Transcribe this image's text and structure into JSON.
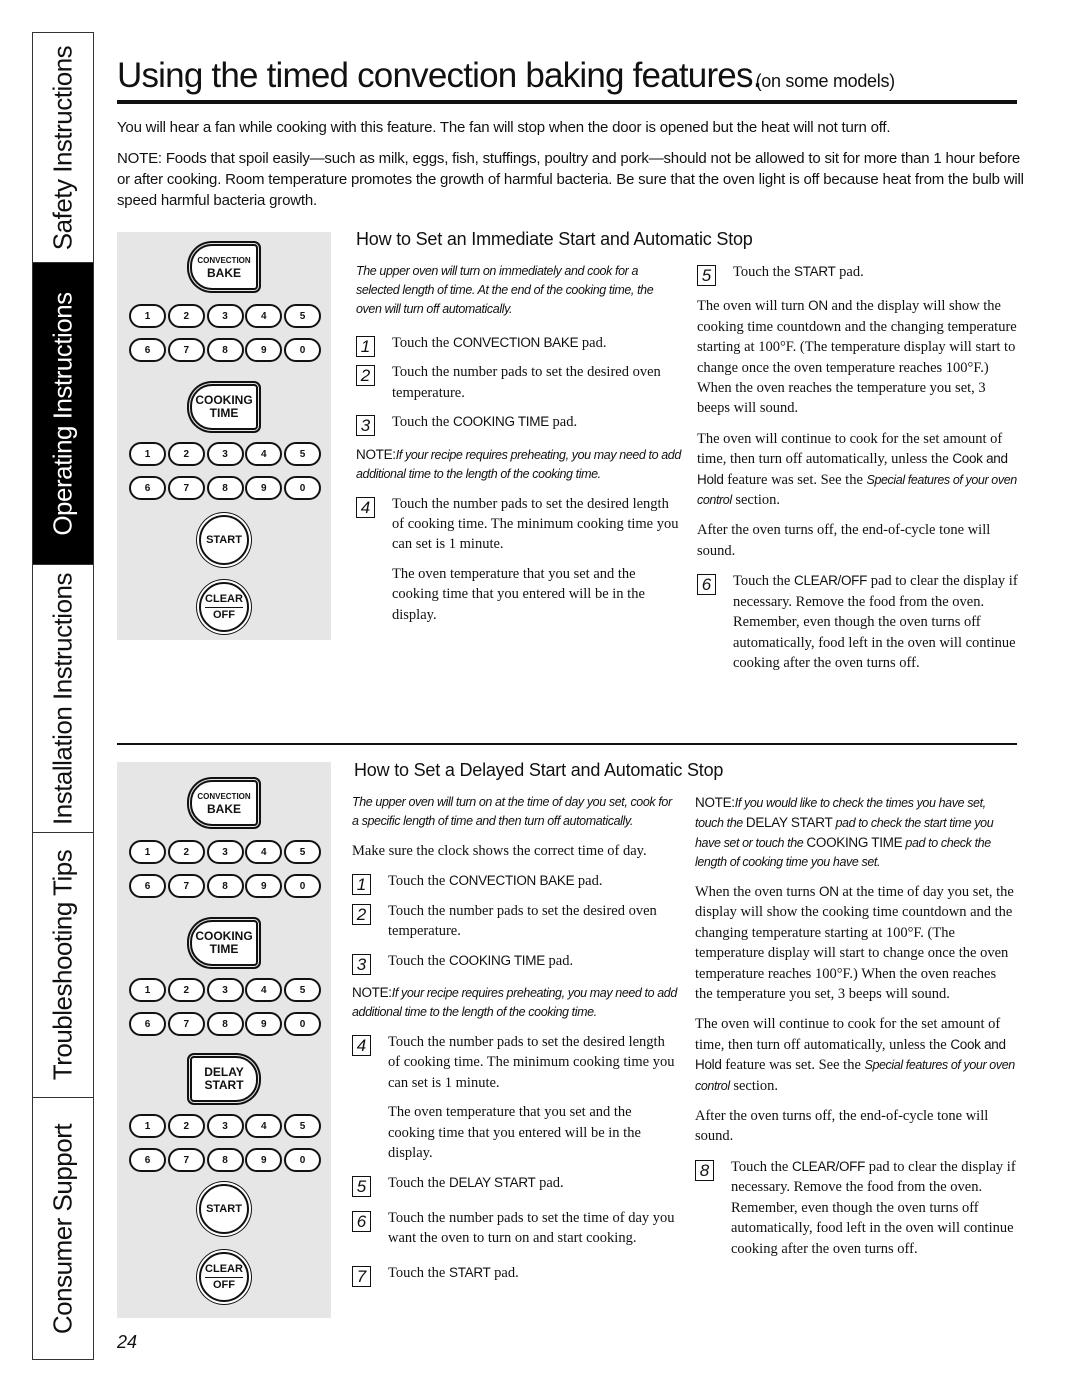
{
  "side_tabs": [
    {
      "label": "Safety Instructions",
      "active": false
    },
    {
      "label": "Operating Instructions",
      "active": true
    },
    {
      "label": "Installation Instructions",
      "active": false
    },
    {
      "label": "Troubleshooting Tips",
      "active": false
    },
    {
      "label": "Consumer Support",
      "active": false
    }
  ],
  "header": {
    "title": "Using the timed convection baking features.",
    "subtitle": "(on some models)"
  },
  "intro": {
    "fan_text": "You will hear a fan while cooking with this feature. The fan will stop when the door is opened but the heat will not turn off.",
    "note_label": "NOTE:",
    "note_text": "Foods that spoil easily—such as milk, eggs, fish, stuffings, poultry and pork—should not be allowed to sit for more than 1 hour before or after cooking. Room temperature promotes the growth of harmful bacteria. Be sure that the oven light is off because heat from the bulb will speed harmful bacteria growth."
  },
  "keypad": {
    "convection_bake": [
      "CONVECTION",
      "BAKE"
    ],
    "cooking_time": [
      "COOKING",
      "TIME"
    ],
    "delay_start": [
      "DELAY",
      "START"
    ],
    "start": "START",
    "clear_off": [
      "CLEAR",
      "OFF"
    ],
    "digits_row1": [
      "1",
      "2",
      "3",
      "4",
      "5"
    ],
    "digits_row2": [
      "6",
      "7",
      "8",
      "9",
      "0"
    ]
  },
  "immediate": {
    "heading": "How to Set an Immediate Start and Automatic Stop",
    "lead": "The upper oven will turn on immediately and cook for a selected length of time. At the end of the cooking time, the oven will turn off automatically.",
    "steps": [
      {
        "num": "1",
        "pre": "Touch the ",
        "key": "CONVECTION BAKE",
        "post": " pad."
      },
      {
        "num": "2",
        "text": "Touch the number pads to set the desired oven temperature."
      },
      {
        "num": "3",
        "pre": "Touch the ",
        "key": "COOKING TIME",
        "post": " pad."
      },
      {
        "num": "4",
        "text": "Touch the number pads to set the desired length of cooking time. The minimum cooking time you can set is 1 minute."
      },
      {
        "num": "5",
        "pre": "Touch the ",
        "key": "START",
        "post": " pad."
      },
      {
        "num": "6",
        "pre": "Touch the ",
        "key": "CLEAR/OFF",
        "post": " pad to clear the display if necessary. Remove the food from the oven. Remember, even though the oven turns off automatically, food left in the oven will continue cooking after the oven turns off."
      }
    ],
    "note_label": "NOTE:",
    "note_text": "If your recipe requires preheating, you may need to add additional time to the length of the cooking time.",
    "step4_followup": "The oven temperature that you set and the cooking time that you entered will be in the display.",
    "on_text_pre": "The oven will turn ",
    "on_key": "ON",
    "on_text_post": " and the display will show the cooking time countdown and the changing temperature starting at 100°F. (The temperature display will start to change once the oven temperature reaches 100°F.) When the oven reaches the temperature you set, 3 beeps will sound.",
    "continue_pre": "The oven will continue to cook for the set amount of time, then turn off automatically, unless the ",
    "continue_key": "Cook and Hold",
    "continue_mid": " feature was set. See the ",
    "continue_ref": "Special features of your oven control",
    "continue_post": " section.",
    "tone_text": "After the oven turns off, the end-of-cycle tone will sound."
  },
  "delayed": {
    "heading": "How to Set a Delayed Start and Automatic Stop",
    "lead": "The upper oven will turn on at the time of day you set, cook for a specific length of time and then turn off automatically.",
    "clock_text": "Make sure the clock shows the correct time of day.",
    "steps": [
      {
        "num": "1",
        "pre": "Touch the ",
        "key": "CONVECTION BAKE",
        "post": " pad."
      },
      {
        "num": "2",
        "text": "Touch the number pads to set the desired oven temperature."
      },
      {
        "num": "3",
        "pre": "Touch the ",
        "key": "COOKING TIME",
        "post": " pad."
      },
      {
        "num": "4",
        "text": "Touch the number pads to set the desired length of cooking time. The minimum cooking time you can set is 1 minute."
      },
      {
        "num": "5",
        "pre": "Touch the ",
        "key": "DELAY START",
        "post": " pad."
      },
      {
        "num": "6",
        "text": "Touch the number pads to set the time of day you want the oven to turn on and start cooking."
      },
      {
        "num": "7",
        "pre": "Touch the ",
        "key": "START",
        "post": " pad."
      },
      {
        "num": "8",
        "pre": "Touch the ",
        "key": "CLEAR/OFF",
        "post": " pad to clear the display if necessary. Remove the food from the oven. Remember, even though the oven turns off automatically, food left in the oven will continue cooking after the oven turns off."
      }
    ],
    "note_label": "NOTE:",
    "note_text": "If your recipe requires preheating, you may need to add additional time to the length of the cooking time.",
    "step4_followup": "The oven temperature that you set and the cooking time that you entered will be in the display.",
    "check_note_label": "NOTE:",
    "check_note_1": "If you would like to check the times you have set, touch the ",
    "check_key_1": "DELAY START",
    "check_note_2": " pad to check the start time you have set or touch the ",
    "check_key_2": "COOKING TIME",
    "check_note_3": " pad to check the length of cooking time you have set.",
    "on_text_pre": "When the oven turns ",
    "on_key": "ON",
    "on_text_post": " at the time of day you set, the display will show the cooking time countdown and the changing temperature starting at 100°F. (The temperature display will start to change once the oven temperature reaches 100°F.) When the oven reaches the temperature you set, 3 beeps will sound.",
    "continue_pre": "The oven will continue to cook for the set amount of time, then turn off automatically, unless the ",
    "continue_key": "Cook and Hold",
    "continue_mid": " feature was set. See the ",
    "continue_ref": "Special features of your oven control",
    "continue_post": " section.",
    "tone_text": "After the oven turns off, the end-of-cycle tone will sound."
  },
  "page_number": "24"
}
